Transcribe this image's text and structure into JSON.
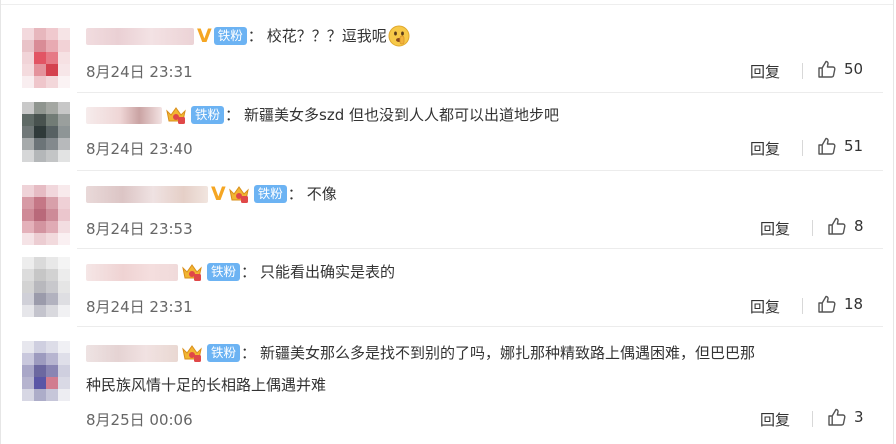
{
  "comments": [
    {
      "badge": "铁粉",
      "has_vip": true,
      "has_crown": false,
      "colon": "：",
      "text": "校花？？？逗我呢",
      "text_line2": "",
      "emoji": "shushing-face-emoji",
      "time": "8月24日 23:31",
      "reply_label": "回复",
      "likes": "50"
    },
    {
      "badge": "铁粉",
      "has_vip": false,
      "has_crown": true,
      "colon": "：",
      "text": "新疆美女多szd 但也没到人人都可以出道地步吧",
      "text_line2": "",
      "emoji": "",
      "time": "8月24日 23:40",
      "reply_label": "回复",
      "likes": "51"
    },
    {
      "badge": "铁粉",
      "has_vip": true,
      "has_crown": true,
      "colon": "：",
      "text": "不像",
      "text_line2": "",
      "emoji": "",
      "time": "8月24日 23:53",
      "reply_label": "回复",
      "likes": "8"
    },
    {
      "badge": "铁粉",
      "has_vip": false,
      "has_crown": true,
      "colon": "：",
      "text": "只能看出确实是表的",
      "text_line2": "",
      "emoji": "",
      "time": "8月24日 23:31",
      "reply_label": "回复",
      "likes": "18"
    },
    {
      "badge": "铁粉",
      "has_vip": false,
      "has_crown": true,
      "colon": "：",
      "text": "新疆美女那么多是找不到别的了吗，娜扎那种精致路上偶遇困难，但巴巴那",
      "text_line2": "种民族风情十足的长相路上偶遇并难",
      "emoji": "",
      "time": "8月25日 00:06",
      "reply_label": "回复",
      "likes": "3"
    }
  ],
  "colors": {
    "badge_bg": "#6cb3f3",
    "vip_gold": "#f5a623",
    "time_gray": "#666666",
    "text": "#333333"
  }
}
